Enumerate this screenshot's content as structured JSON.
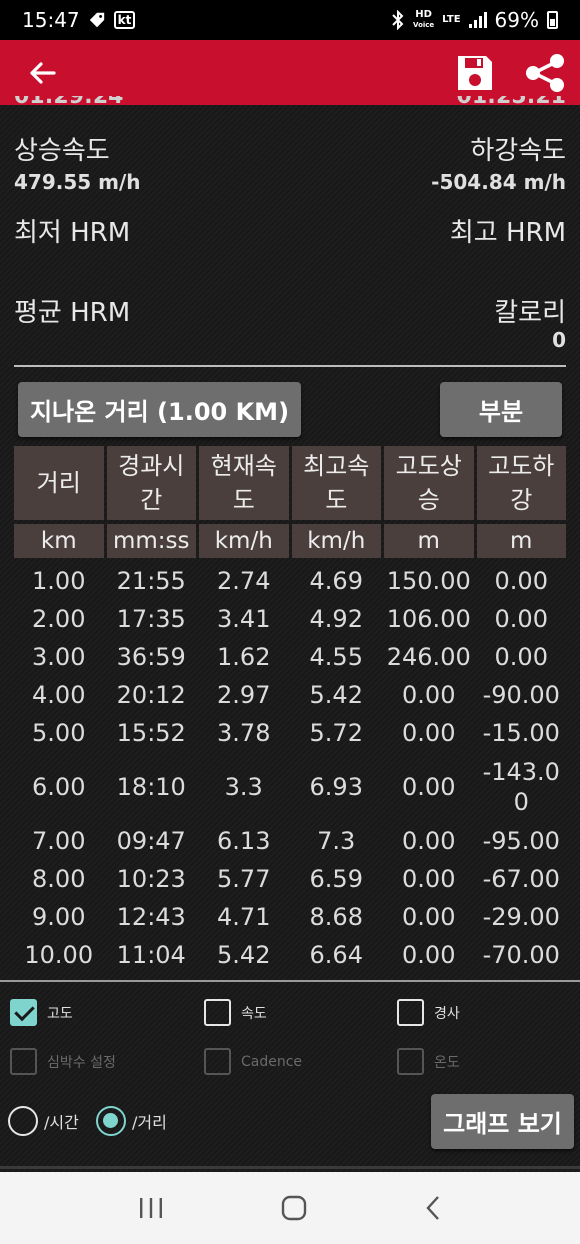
{
  "status_bar": {
    "time": "15:47",
    "carrier": "kt",
    "hd_top": "HD",
    "hd_bottom": "Voice",
    "lte": "LTE",
    "battery": "69%"
  },
  "app_bar": {
    "back_icon": "arrow-left-icon",
    "save_icon": "save-icon",
    "share_icon": "share-icon"
  },
  "summary": {
    "partial_left": "01:29:24",
    "partial_right": "01:25:21",
    "ascent_speed_label": "상승속도",
    "ascent_speed_value": "479.55 m/h",
    "descent_speed_label": "하강속도",
    "descent_speed_value": "-504.84 m/h",
    "min_hrm_label": "최저 HRM",
    "max_hrm_label": "최고 HRM",
    "avg_hrm_label": "평균 HRM",
    "calorie_label": "칼로리",
    "calorie_value": "0"
  },
  "buttons": {
    "distance_label": "지나온 거리 (1.00  KM)",
    "section_label": "부분",
    "graph_label": "그래프 보기"
  },
  "table": {
    "headers": [
      "거리",
      "경과시간",
      "현재속도",
      "최고속도",
      "고도상승",
      "고도하강"
    ],
    "units": [
      "km",
      "mm:ss",
      "km/h",
      "km/h",
      "m",
      "m"
    ],
    "rows": [
      [
        "1.00",
        "21:55",
        "2.74",
        "4.69",
        "150.00",
        "0.00"
      ],
      [
        "2.00",
        "17:35",
        "3.41",
        "4.92",
        "106.00",
        "0.00"
      ],
      [
        "3.00",
        "36:59",
        "1.62",
        "4.55",
        "246.00",
        "0.00"
      ],
      [
        "4.00",
        "20:12",
        "2.97",
        "5.42",
        "0.00",
        "-90.00"
      ],
      [
        "5.00",
        "15:52",
        "3.78",
        "5.72",
        "0.00",
        "-15.00"
      ],
      [
        "6.00",
        "18:10",
        "3.3",
        "6.93",
        "0.00",
        "-143.00"
      ],
      [
        "7.00",
        "09:47",
        "6.13",
        "7.3",
        "0.00",
        "-95.00"
      ],
      [
        "8.00",
        "10:23",
        "5.77",
        "6.59",
        "0.00",
        "-67.00"
      ],
      [
        "9.00",
        "12:43",
        "4.71",
        "8.68",
        "0.00",
        "-29.00"
      ],
      [
        "10.00",
        "11:04",
        "5.42",
        "6.64",
        "0.00",
        "-70.00"
      ]
    ]
  },
  "options": {
    "altitude": "고도",
    "speed": "속도",
    "slope": "경사",
    "heart_rate": "심박수 설정",
    "cadence": "Cadence",
    "temperature": "온도",
    "by_time": "/시간",
    "by_distance": "/거리"
  },
  "colors": {
    "app_bar": "#c8102e",
    "accent": "#7fd4cd",
    "header_cell": "#4a3f3d"
  }
}
